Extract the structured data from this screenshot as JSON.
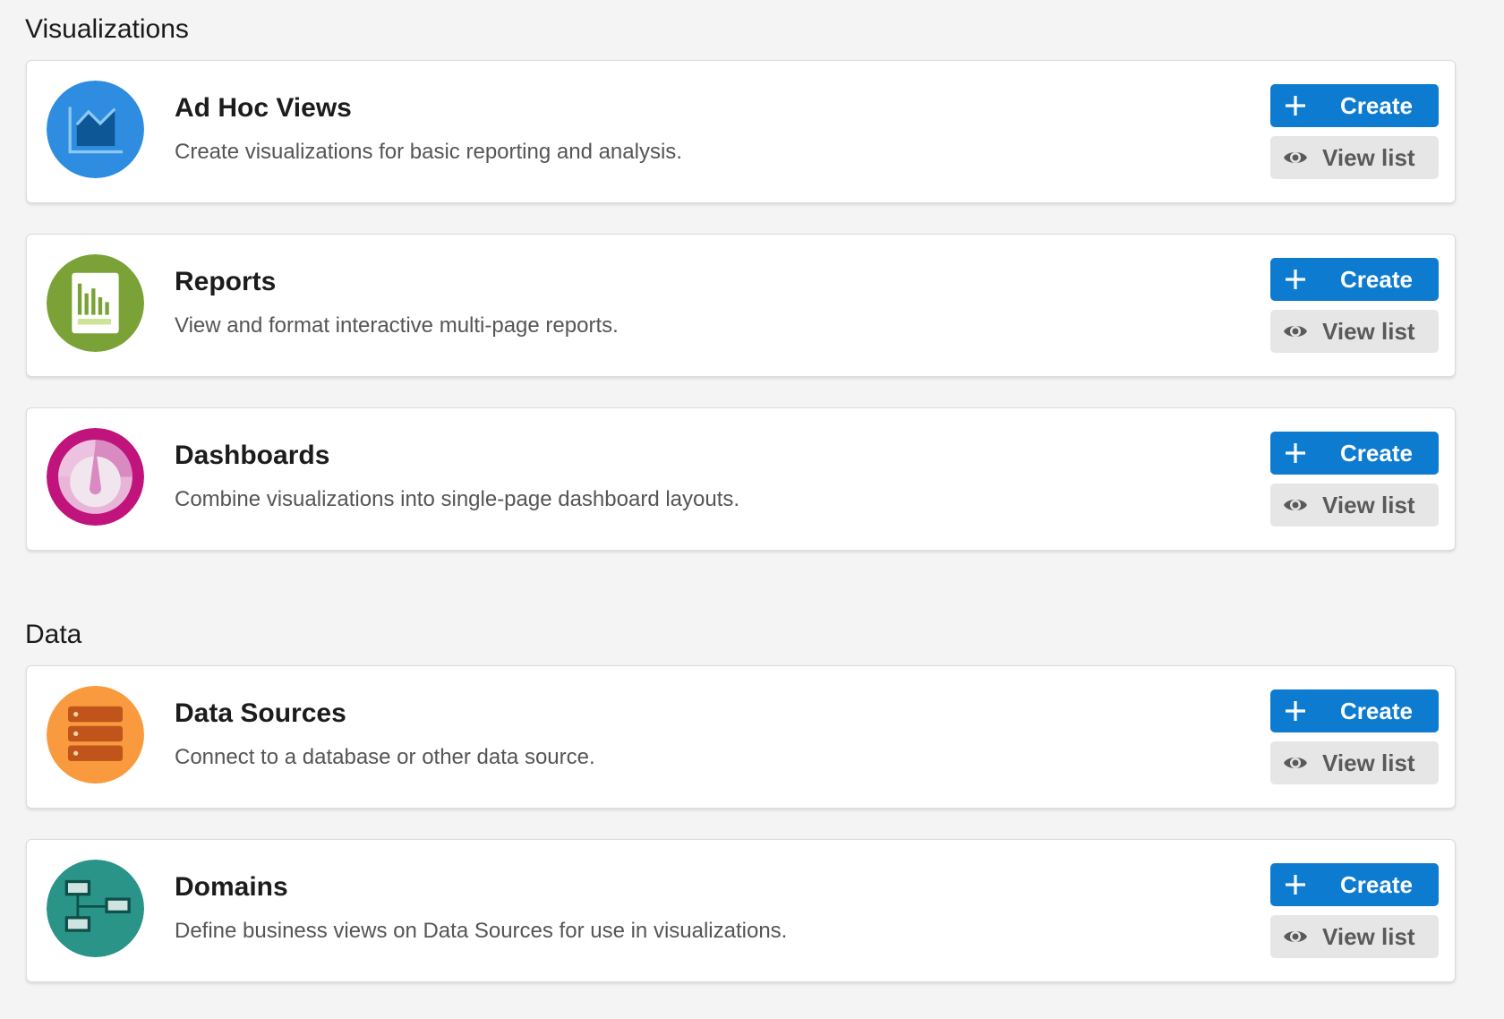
{
  "sections": [
    {
      "title": "Visualizations",
      "items": [
        {
          "title": "Ad Hoc Views",
          "description": "Create visualizations for basic reporting and analysis.",
          "icon": "line-chart-icon",
          "icon_color": "#2e8de0",
          "create_label": "Create",
          "view_label": "View list"
        },
        {
          "title": "Reports",
          "description": "View and format interactive multi-page reports.",
          "icon": "bar-report-icon",
          "icon_color": "#7aa236",
          "create_label": "Create",
          "view_label": "View list"
        },
        {
          "title": "Dashboards",
          "description": "Combine visualizations into single-page dashboard layouts.",
          "icon": "gauge-icon",
          "icon_color": "#c0137b",
          "create_label": "Create",
          "view_label": "View list"
        }
      ]
    },
    {
      "title": "Data",
      "items": [
        {
          "title": "Data Sources",
          "description": "Connect to a database or other data source.",
          "icon": "database-icon",
          "icon_color": "#f99a3e",
          "create_label": "Create",
          "view_label": "View list"
        },
        {
          "title": "Domains",
          "description": "Define business views on Data Sources for use in visualizations.",
          "icon": "hierarchy-icon",
          "icon_color": "#2a9488",
          "create_label": "Create",
          "view_label": "View list"
        }
      ]
    }
  ],
  "colors": {
    "create_button": "#0d7bd0",
    "view_button": "#e6e6e6",
    "page_background": "#f4f4f4"
  }
}
